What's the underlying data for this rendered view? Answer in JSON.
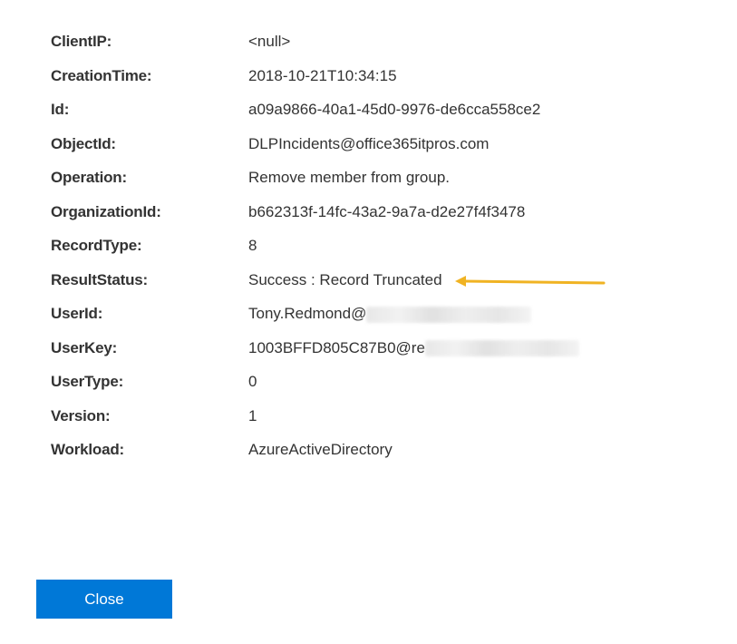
{
  "details": [
    {
      "label": "ClientIP:",
      "value": "<null>"
    },
    {
      "label": "CreationTime:",
      "value": "2018-10-21T10:34:15"
    },
    {
      "label": "Id:",
      "value": "a09a9866-40a1-45d0-9976-de6cca558ce2"
    },
    {
      "label": "ObjectId:",
      "value": "DLPIncidents@office365itpros.com"
    },
    {
      "label": "Operation:",
      "value": "Remove member from group."
    },
    {
      "label": "OrganizationId:",
      "value": "b662313f-14fc-43a2-9a7a-d2e27f4f3478"
    },
    {
      "label": "RecordType:",
      "value": "8"
    },
    {
      "label": "ResultStatus:",
      "value": "Success : Record Truncated"
    },
    {
      "label": "UserId:",
      "value": "Tony.Redmond@"
    },
    {
      "label": "UserKey:",
      "value": "1003BFFD805C87B0@re"
    },
    {
      "label": "UserType:",
      "value": "0"
    },
    {
      "label": "Version:",
      "value": "1"
    },
    {
      "label": "Workload:",
      "value": "AzureActiveDirectory"
    }
  ],
  "close_button": {
    "label": "Close"
  },
  "colors": {
    "button_bg": "#0078d7",
    "button_text": "#ffffff",
    "arrow": "#f0b323",
    "text": "#333333"
  }
}
